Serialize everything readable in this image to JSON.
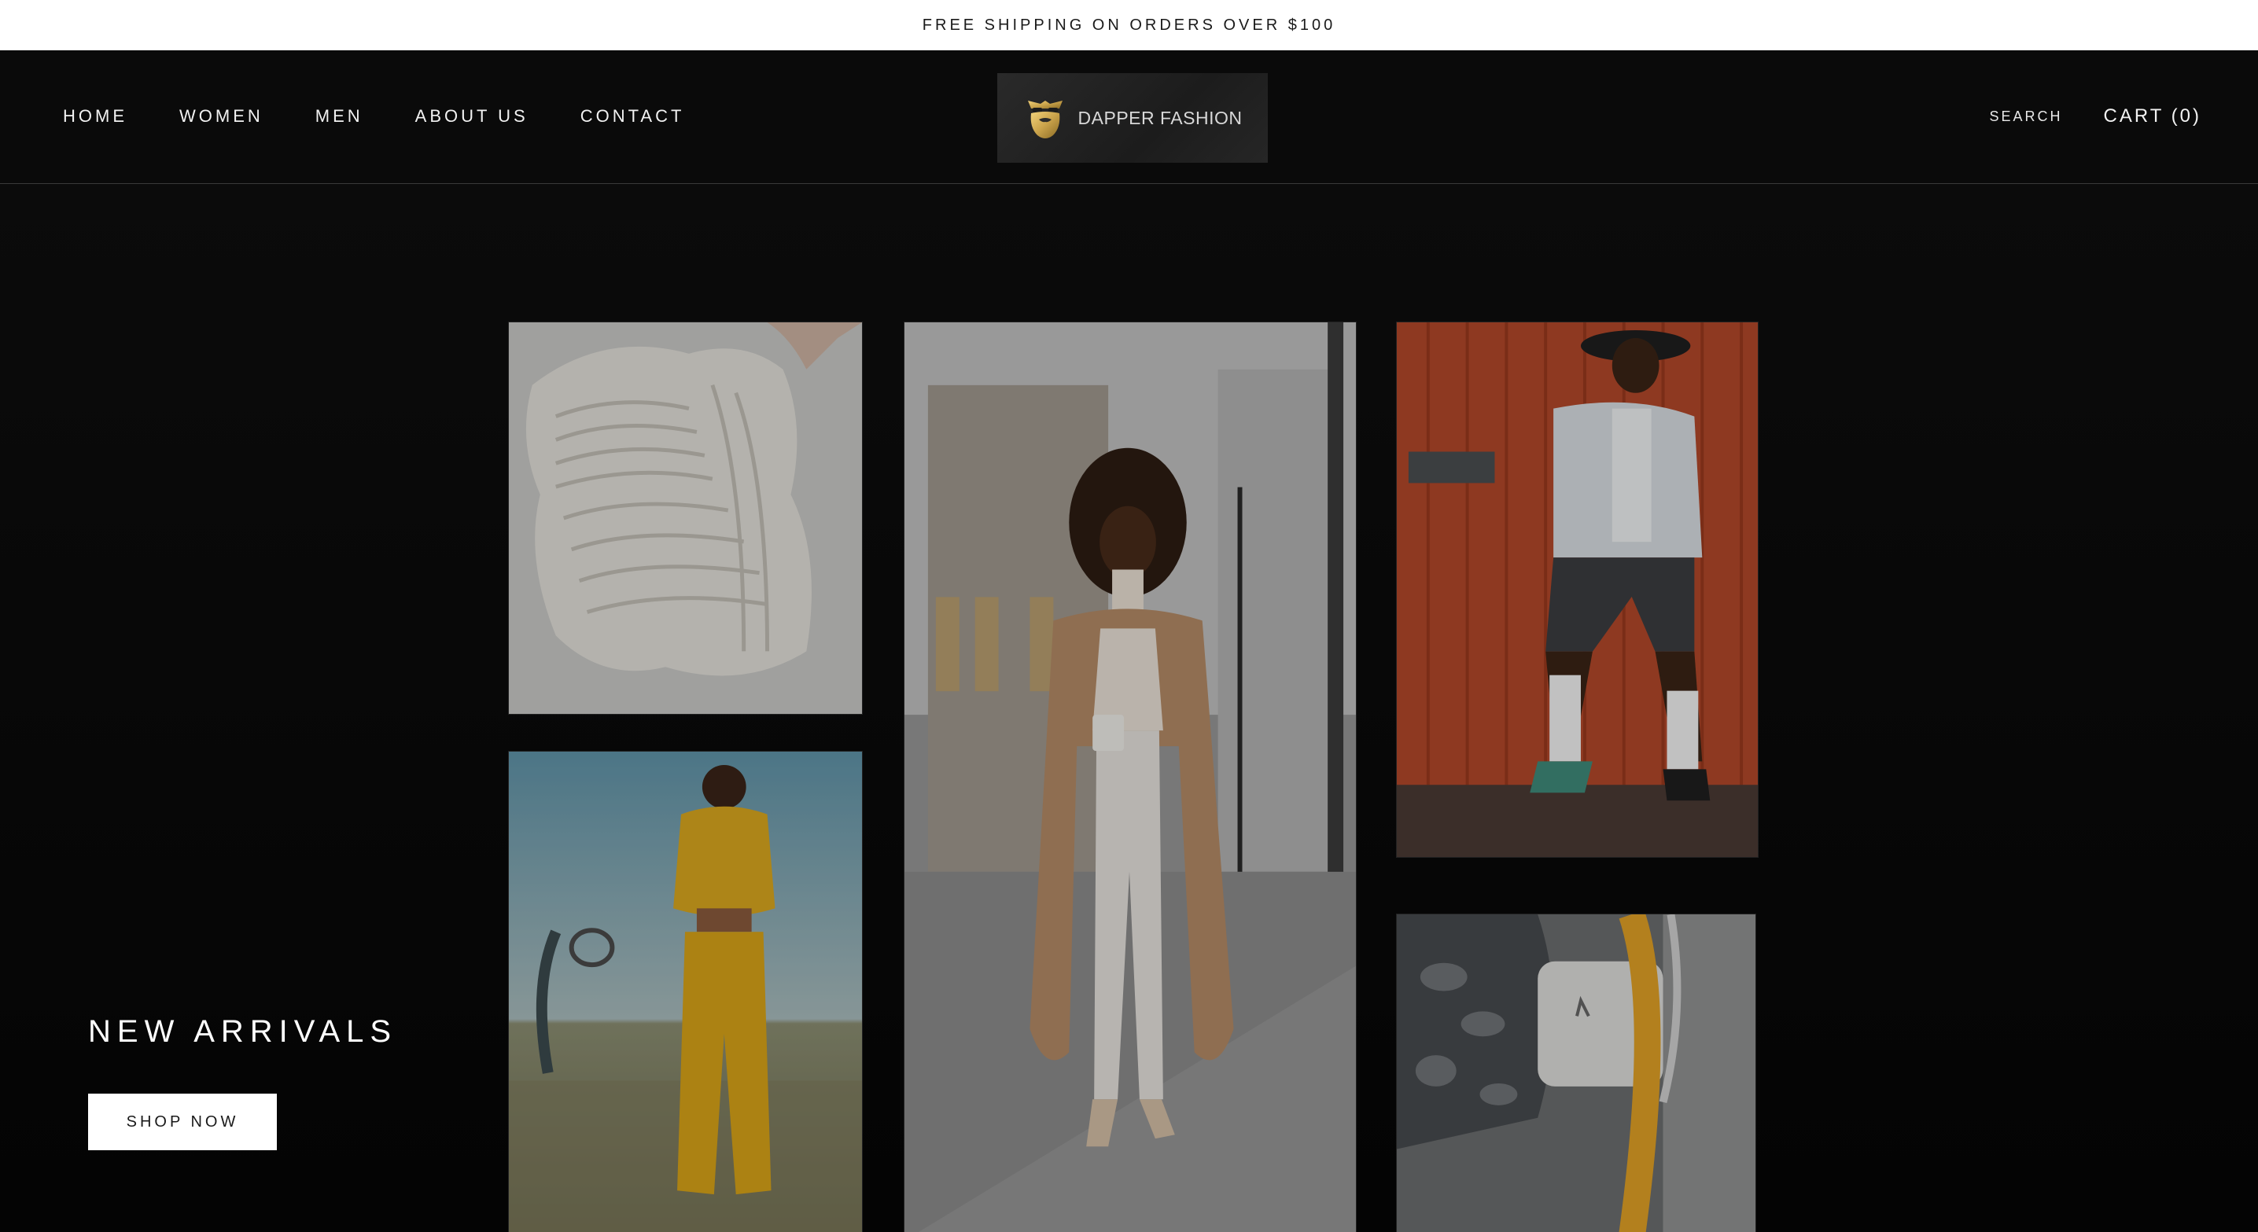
{
  "announcement": {
    "text": "FREE SHIPPING ON ORDERS OVER $100"
  },
  "nav": {
    "items": [
      {
        "label": "HOME"
      },
      {
        "label": "WOMEN"
      },
      {
        "label": "MEN"
      },
      {
        "label": "ABOUT US"
      },
      {
        "label": "CONTACT"
      }
    ],
    "search_label": "SEARCH",
    "cart_label": "CART (0)"
  },
  "logo": {
    "text": "DAPPER FASHION",
    "icon": "bearded-gentleman-logo-icon"
  },
  "hero": {
    "headline": "NEW ARRIVALS",
    "button_label": "SHOP NOW",
    "photos": [
      {
        "subject": "knit-sweater-photo"
      },
      {
        "subject": "woman-camel-coat-photo"
      },
      {
        "subject": "man-white-jacket-photo"
      },
      {
        "subject": "woman-yellow-tracksuit-photo"
      },
      {
        "subject": "handbag-strap-photo"
      }
    ]
  },
  "colors": {
    "background": "#050505",
    "announcement_bg": "#ffffff",
    "text_light": "#ffffff",
    "logo_gold": "#c9a24a"
  }
}
